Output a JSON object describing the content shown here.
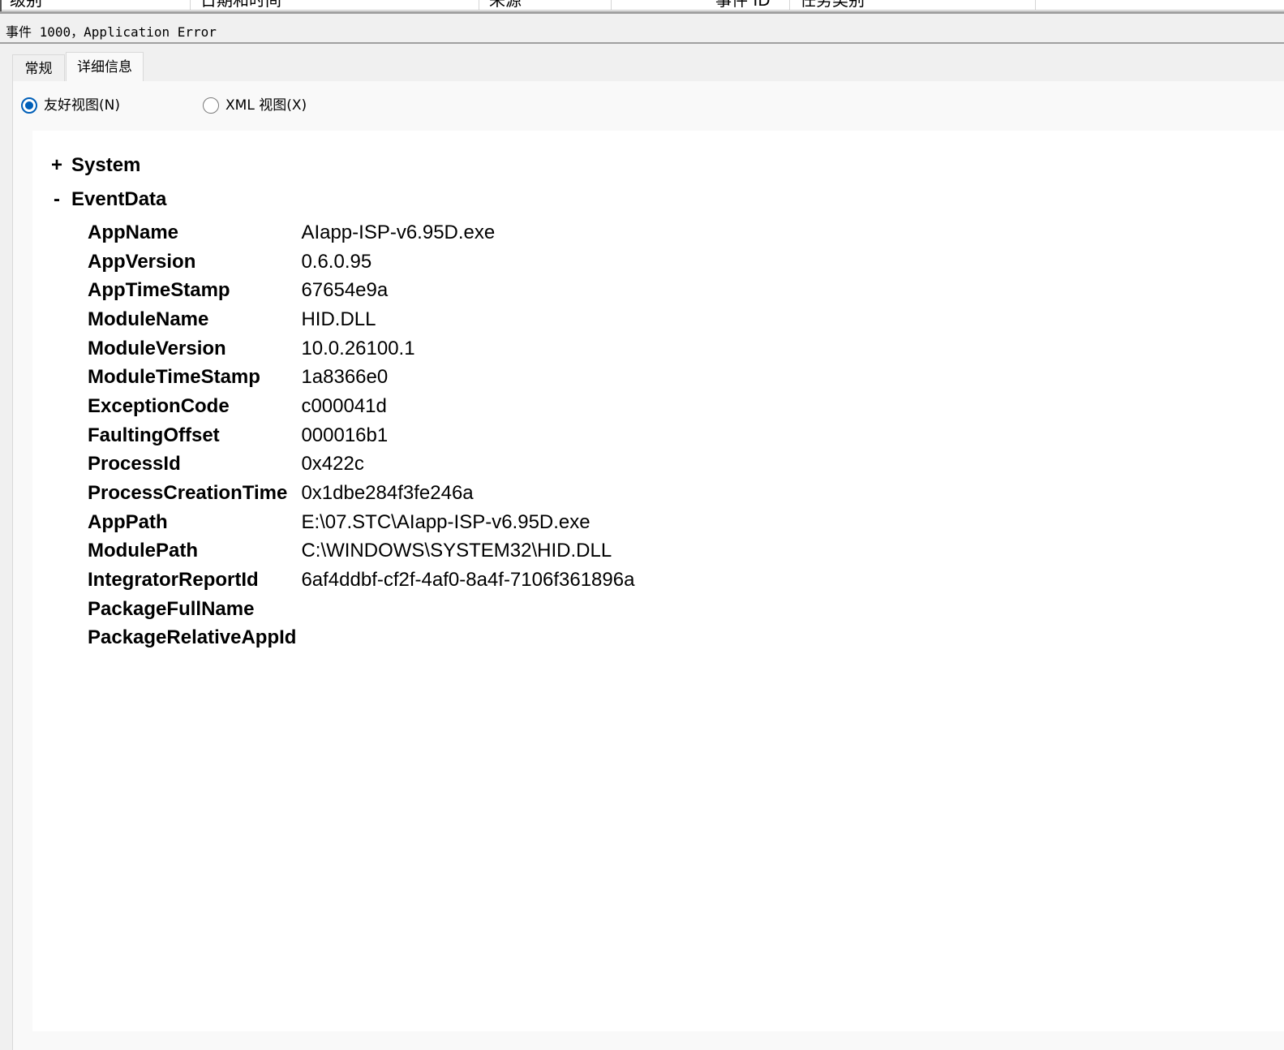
{
  "list_header": {
    "columns": [
      "级别",
      "日期和时间",
      "来源",
      "事件 ID",
      "任务类别"
    ]
  },
  "window": {
    "title": "事件 1000，Application Error"
  },
  "tabs": [
    {
      "label": "常规",
      "active": false
    },
    {
      "label": "详细信息",
      "active": true
    }
  ],
  "view_options": {
    "friendly": {
      "label": "友好视图(N)",
      "checked": true
    },
    "xml": {
      "label": "XML 视图(X)",
      "checked": false
    }
  },
  "tree": {
    "system": {
      "toggle": "+",
      "name": "System"
    },
    "event_data": {
      "toggle": "-",
      "name": "EventData"
    }
  },
  "event_data": [
    {
      "key": "AppName",
      "value": "AIapp-ISP-v6.95D.exe"
    },
    {
      "key": "AppVersion",
      "value": "0.6.0.95"
    },
    {
      "key": "AppTimeStamp",
      "value": "67654e9a"
    },
    {
      "key": "ModuleName",
      "value": "HID.DLL"
    },
    {
      "key": "ModuleVersion",
      "value": "10.0.26100.1"
    },
    {
      "key": "ModuleTimeStamp",
      "value": "1a8366e0"
    },
    {
      "key": "ExceptionCode",
      "value": "c000041d"
    },
    {
      "key": "FaultingOffset",
      "value": "000016b1"
    },
    {
      "key": "ProcessId",
      "value": "0x422c"
    },
    {
      "key": "ProcessCreationTime",
      "value": "0x1dbe284f3fe246a"
    },
    {
      "key": "AppPath",
      "value": "E:\\07.STC\\AIapp-ISP-v6.95D.exe"
    },
    {
      "key": "ModulePath",
      "value": "C:\\WINDOWS\\SYSTEM32\\HID.DLL"
    },
    {
      "key": "IntegratorReportId",
      "value": "6af4ddbf-cf2f-4af0-8a4f-7106f361896a"
    },
    {
      "key": "PackageFullName",
      "value": ""
    },
    {
      "key": "PackageRelativeAppId",
      "value": ""
    }
  ],
  "colors": {
    "radio_accent": "#005fb8",
    "panel_bg": "#f0f0f0",
    "content_bg": "#ffffff"
  }
}
